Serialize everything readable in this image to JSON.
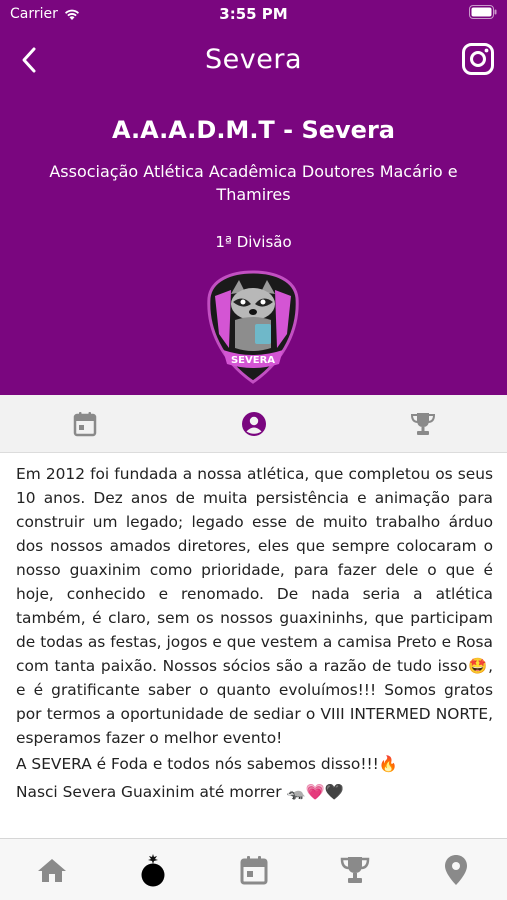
{
  "status_bar": {
    "carrier": "Carrier",
    "time": "3:55 PM"
  },
  "nav": {
    "title": "Severa",
    "back_icon": "chevron-left-icon",
    "social_icon": "instagram-icon"
  },
  "team": {
    "short_name": "A.A.A.D.M.T - Severa",
    "full_name": "Associação Atlética Acadêmica Doutores Macário e Thamires",
    "division": "1ª Divisão",
    "logo_text": "SEVERA"
  },
  "tabs": [
    {
      "icon": "calendar-icon",
      "active": false
    },
    {
      "icon": "profile-icon",
      "active": true
    },
    {
      "icon": "trophy-icon",
      "active": false
    }
  ],
  "about": {
    "paragraph": "Em 2012 foi fundada a nossa atlética, que  completou os seus 10 anos. Dez anos de muita persistência e animação para construir um legado; legado esse de muito trabalho árduo dos nossos amados diretores, eles que sempre colocaram o nosso guaxinim como prioridade, para fazer dele o que é hoje, conhecido e renomado. De nada seria a atlética também, é claro, sem os nossos guaxininhs, que participam de todas as festas, jogos e que vestem a camisa Preto e Rosa com tanta paixão. Nossos sócios são a razão de tudo isso🤩, e é gratificante saber o quanto evoluímos!!! Somos gratos por termos a oportunidade de sediar o VIII INTERMED NORTE, esperamos fazer o melhor evento!",
    "line2": "A SEVERA é Foda e todos nós sabemos disso!!!🔥",
    "line3": "Nasci Severa Guaxinim até morrer 🦡💗🖤"
  },
  "bottom_nav": [
    {
      "icon": "home-icon"
    },
    {
      "icon": "bomb-icon"
    },
    {
      "icon": "calendar-icon"
    },
    {
      "icon": "trophy-icon"
    },
    {
      "icon": "location-pin-icon"
    }
  ],
  "colors": {
    "header_bg": "#7a067f",
    "accent": "#7a067f",
    "inactive_icon": "#8a8a8a"
  }
}
